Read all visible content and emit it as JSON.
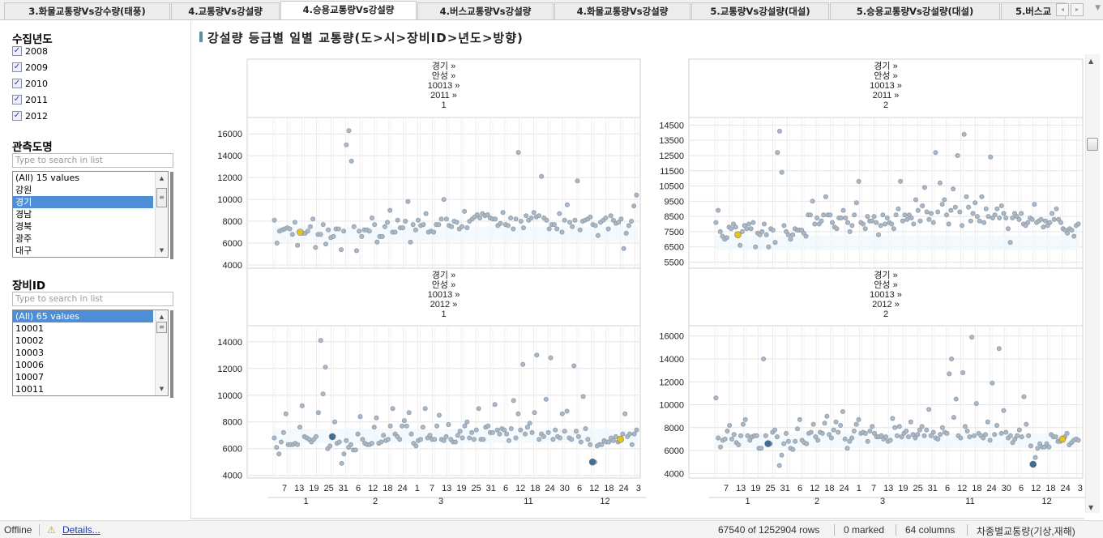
{
  "tabs": [
    {
      "label": "3.화물교통량Vs강수량(태풍)",
      "active": false
    },
    {
      "label": "4.교통량Vs강설량",
      "active": false
    },
    {
      "label": "4.승용교통량Vs강설량",
      "active": true
    },
    {
      "label": "4.버스교통량Vs강설량",
      "active": false
    },
    {
      "label": "4.화물교통량Vs강설량",
      "active": false
    },
    {
      "label": "5.교통량Vs강설량(대설)",
      "active": false
    },
    {
      "label": "5.승용교통량Vs강설량(대설)",
      "active": false
    },
    {
      "label": "5.버스교",
      "active": false
    }
  ],
  "tab_controls": {
    "prev": "◂",
    "next": "▸",
    "menu": "▼"
  },
  "filters": {
    "year": {
      "title": "수집년도",
      "items": [
        {
          "label": "2008",
          "checked": true
        },
        {
          "label": "2009",
          "checked": true
        },
        {
          "label": "2010",
          "checked": true
        },
        {
          "label": "2011",
          "checked": true
        },
        {
          "label": "2012",
          "checked": true
        }
      ]
    },
    "province": {
      "title": "관측도명",
      "search_placeholder": "Type to search in list",
      "items": [
        "(All) 15 values",
        "강원",
        "경기",
        "경남",
        "경북",
        "광주",
        "대구"
      ],
      "selected": "경기"
    },
    "device": {
      "title": "장비ID",
      "search_placeholder": "Type to search in list",
      "items": [
        "(All) 65 values",
        "10001",
        "10002",
        "10003",
        "10006",
        "10007",
        "10011"
      ],
      "selected": "(All) 65 values"
    }
  },
  "viz": {
    "title": "강설량 등급별 일별 교통량(도>시>장비ID>년도>방향)"
  },
  "colors": {
    "point": "#aab9c8",
    "point_stroke": "#8e9aa6",
    "highlight_yellow": "#e8c21c",
    "highlight_blue": "#3c6e96",
    "band": "#eef6fb",
    "grid": "#e4e4e4"
  },
  "chart_data": [
    {
      "type": "scatter",
      "header": [
        "경기 »",
        "안성 »",
        "10013 »",
        "2011 »",
        "1"
      ],
      "yticks": [
        4000,
        6000,
        8000,
        10000,
        12000,
        14000,
        16000
      ],
      "ylim": [
        3700,
        17500
      ],
      "values": [
        8100,
        6000,
        7100,
        7200,
        7300,
        7400,
        7300,
        6800,
        7900,
        5800,
        7000,
        6900,
        6900,
        7100,
        7500,
        8200,
        5600,
        6800,
        6800,
        7700,
        5900,
        7200,
        6500,
        6600,
        7300,
        7300,
        5400,
        7100,
        15000,
        16300,
        13500,
        7500,
        5300,
        7100,
        6600,
        7200,
        7200,
        7100,
        8300,
        7700,
        6100,
        6600,
        6600,
        7500,
        7900,
        9000,
        7000,
        7000,
        8100,
        7400,
        7400,
        8000,
        9800,
        6100,
        7700,
        7200,
        8100,
        7600,
        7700,
        8700,
        7000,
        7100,
        7000,
        7700,
        7700,
        8200,
        10000,
        8200,
        7600,
        7500,
        8000,
        7900,
        7300,
        7500,
        8900,
        7400,
        8000,
        8200,
        8400,
        8600,
        8300,
        8700,
        8500,
        8600,
        8300,
        8200,
        8200,
        7600,
        7800,
        8800,
        7700,
        7600,
        8300,
        7300,
        8200,
        14300,
        8000,
        7400,
        8500,
        8100,
        8300,
        8800,
        8400,
        8500,
        12100,
        8300,
        8100,
        7300,
        7700,
        7700,
        7300,
        8700,
        7000,
        8100,
        9500,
        7900,
        7500,
        8100,
        11700,
        7200,
        8000,
        8100,
        8200,
        8400,
        7700,
        7600,
        6700,
        7900,
        8100,
        8300,
        7300,
        8500,
        8100,
        7800,
        7900,
        8200,
        5500,
        6900,
        7600,
        8000,
        9400,
        10400
      ],
      "highlights": [
        {
          "index": 10,
          "color": "yellow"
        }
      ]
    },
    {
      "type": "scatter",
      "header": [
        "경기 »",
        "안성 »",
        "10013 »",
        "2011 »",
        "2"
      ],
      "yticks": [
        5500,
        6500,
        7500,
        8500,
        9500,
        10500,
        11500,
        12500,
        13500,
        14500
      ],
      "ylim": [
        5100,
        15000
      ],
      "values": [
        8100,
        8900,
        7500,
        7200,
        7000,
        7100,
        7800,
        7700,
        8000,
        7800,
        7300,
        6600,
        7500,
        7900,
        7700,
        8000,
        7700,
        8100,
        6500,
        7400,
        7300,
        7500,
        8000,
        7300,
        6500,
        7700,
        7600,
        6800,
        12700,
        14100,
        11400,
        7900,
        7500,
        7300,
        7000,
        7300,
        7700,
        7600,
        7600,
        7600,
        7400,
        7200,
        8600,
        8600,
        9500,
        8000,
        8400,
        8000,
        8200,
        8600,
        9800,
        8600,
        8600,
        8100,
        7800,
        7700,
        8400,
        8400,
        8900,
        8400,
        8100,
        7500,
        7900,
        8600,
        9400,
        10800,
        8100,
        8000,
        7700,
        8500,
        8200,
        8200,
        8500,
        8100,
        7300,
        7900,
        8600,
        8000,
        8400,
        8100,
        8000,
        7700,
        8600,
        9000,
        10800,
        8200,
        8600,
        8300,
        8600,
        8400,
        8000,
        9600,
        8900,
        8200,
        9200,
        10400,
        8800,
        8300,
        8700,
        8100,
        12700,
        8800,
        10700,
        9300,
        9600,
        8600,
        8000,
        8900,
        10300,
        9100,
        12500,
        8800,
        7900,
        13900,
        9800,
        9100,
        8200,
        8700,
        9400,
        8500,
        8200,
        9800,
        8100,
        9000,
        8500,
        12400,
        8400,
        8600,
        9000,
        8400,
        9200,
        8700,
        8400,
        7700,
        6800,
        8400,
        8700,
        8500,
        8300,
        8700,
        8000,
        7900,
        8100,
        8400,
        8300,
        9300,
        8100,
        8200,
        8300,
        7800,
        8200,
        7900,
        8100,
        8700,
        8300,
        9000,
        8300,
        8100,
        7700,
        7600,
        7400,
        7700,
        7600,
        7200,
        7900,
        8000
      ],
      "highlights": [
        {
          "index": 10,
          "color": "yellow"
        }
      ]
    },
    {
      "type": "scatter",
      "header": [
        "경기 »",
        "안성 »",
        "10013 »",
        "2012 »",
        "1"
      ],
      "yticks": [
        4000,
        6000,
        8000,
        10000,
        12000,
        14000
      ],
      "ylim": [
        3800,
        15200
      ],
      "values": [
        6800,
        6100,
        5600,
        6500,
        7200,
        8600,
        6300,
        6300,
        6300,
        6400,
        6300,
        7600,
        9200,
        6900,
        6800,
        6700,
        6500,
        6700,
        6900,
        8700,
        14100,
        10100,
        12100,
        6000,
        6200,
        6900,
        8000,
        6400,
        6500,
        4900,
        5600,
        6600,
        6100,
        6300,
        5900,
        5900,
        7100,
        8400,
        6700,
        6400,
        6300,
        6300,
        6400,
        7600,
        8300,
        6400,
        6500,
        7000,
        6600,
        6700,
        7700,
        9000,
        7100,
        6900,
        6700,
        7700,
        8100,
        7700,
        8700,
        7100,
        6400,
        6200,
        6600,
        6700,
        7600,
        9000,
        6800,
        7000,
        6700,
        6700,
        7700,
        8500,
        6700,
        6600,
        6900,
        7800,
        6700,
        6500,
        6500,
        7000,
        7300,
        6800,
        7700,
        8000,
        6800,
        7200,
        6700,
        7400,
        9000,
        6700,
        6700,
        7600,
        7700,
        7200,
        7200,
        9300,
        7400,
        7100,
        7500,
        7400,
        7100,
        6600,
        7500,
        9600,
        6800,
        8600,
        7400,
        12300,
        7100,
        7600,
        7900,
        7200,
        8700,
        13000,
        6700,
        7100,
        6900,
        9700,
        7200,
        12800,
        6700,
        7400,
        6900,
        6800,
        8600,
        7300,
        8800,
        6800,
        6700,
        12200,
        7300,
        6900,
        6500,
        9900,
        7500,
        6700,
        6300,
        5000,
        5000,
        6200,
        6300,
        6300,
        6600,
        6500,
        6500,
        6800,
        6600,
        6900,
        6500,
        6700,
        7100,
        8600,
        6900,
        7100,
        6300,
        7100,
        7400
      ],
      "highlights": [
        {
          "index": 25,
          "color": "blue"
        },
        {
          "index": 137,
          "color": "blue"
        },
        {
          "index": 149,
          "color": "yellow"
        }
      ]
    },
    {
      "type": "scatter",
      "header": [
        "경기 »",
        "안성 »",
        "10013 »",
        "2012 »",
        "2"
      ],
      "yticks": [
        4000,
        6000,
        8000,
        10000,
        12000,
        14000,
        16000
      ],
      "ylim": [
        3600,
        16900
      ],
      "values": [
        10600,
        7100,
        6300,
        6900,
        7000,
        7700,
        8200,
        7000,
        7400,
        6700,
        6500,
        7300,
        8300,
        8700,
        7300,
        6900,
        7200,
        7300,
        7300,
        6200,
        6200,
        14000,
        7300,
        6600,
        6600,
        7600,
        7800,
        7200,
        4700,
        5600,
        6600,
        7500,
        6800,
        6200,
        6100,
        6800,
        7900,
        8700,
        6900,
        6700,
        6600,
        7500,
        7600,
        8300,
        7200,
        6900,
        7600,
        7500,
        8400,
        9000,
        7400,
        7100,
        7800,
        8500,
        7600,
        8200,
        9400,
        7000,
        6200,
        6800,
        7100,
        7700,
        8300,
        8700,
        7500,
        7600,
        7500,
        6800,
        7700,
        8100,
        7500,
        7200,
        7200,
        7300,
        7000,
        7200,
        6800,
        6900,
        8800,
        8000,
        7300,
        8100,
        7200,
        7500,
        7700,
        7200,
        8500,
        7400,
        7100,
        7400,
        7800,
        8100,
        7300,
        7800,
        9600,
        7300,
        7600,
        7100,
        7000,
        7400,
        8000,
        7600,
        7500,
        12700,
        14000,
        8900,
        10500,
        7300,
        7100,
        12800,
        8100,
        7700,
        7200,
        15900,
        7300,
        10100,
        7500,
        7300,
        7100,
        7400,
        8500,
        6900,
        11900,
        7400,
        8200,
        14900,
        7500,
        9500,
        7600,
        7100,
        7300,
        6700,
        7000,
        7300,
        7800,
        7200,
        10700,
        8300,
        7300,
        6400,
        4800,
        5400,
        6200,
        6600,
        6300,
        6300,
        6600,
        6300,
        7400,
        7200,
        7200,
        6800,
        6800,
        7000,
        7200,
        7500,
        6500,
        6700,
        6900,
        7000,
        6900
      ],
      "highlights": [
        {
          "index": 23,
          "color": "blue"
        },
        {
          "index": 140,
          "color": "blue"
        },
        {
          "index": 153,
          "color": "yellow"
        }
      ]
    }
  ],
  "x_axis": {
    "day_ticks": [
      "7",
      "13",
      "19",
      "25",
      "31",
      "6",
      "12",
      "18",
      "24",
      "1",
      "7",
      "13",
      "19",
      "25",
      "31",
      "6",
      "12",
      "18",
      "24",
      "30",
      "6",
      "12",
      "18",
      "24",
      "3"
    ],
    "month_labels": [
      "1",
      "2",
      "3",
      "11",
      "12"
    ]
  },
  "status": {
    "offline": "Offline",
    "details": "Details...",
    "rows": "67540 of 1252904 rows",
    "marked": "0 marked",
    "columns": "64 columns",
    "table": "차종별교통량(기상,재해)"
  }
}
